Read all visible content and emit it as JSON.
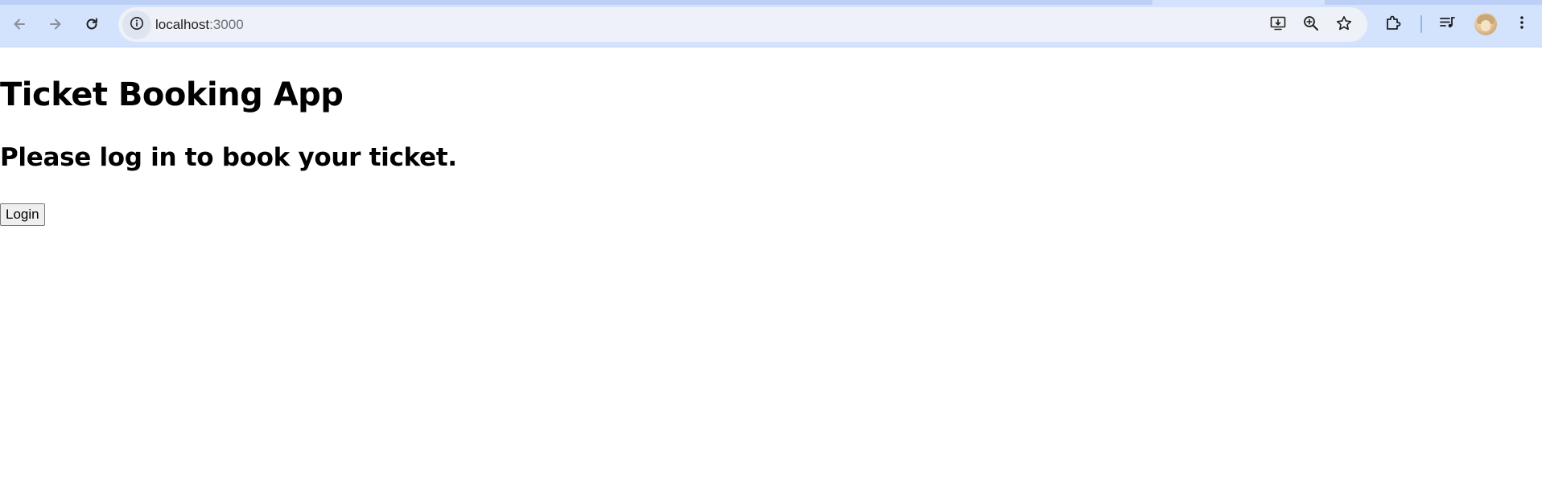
{
  "browser": {
    "url_host": "localhost",
    "url_port": ":3000",
    "icons": {
      "back": "arrow-back-icon",
      "forward": "arrow-forward-icon",
      "reload": "reload-icon",
      "site_info": "info-icon",
      "install_app": "install-app-icon",
      "zoom": "zoom-in-icon",
      "bookmark": "star-icon",
      "extensions": "puzzle-icon",
      "media": "media-queue-icon",
      "profile": "avatar",
      "menu": "more-vert-icon"
    },
    "colors": {
      "toolbar_bg": "#d3e3fd",
      "omnibox_bg": "#eef1f7"
    }
  },
  "page": {
    "title": "Ticket Booking App",
    "subtitle": "Please log in to book your ticket.",
    "login_button": "Login"
  }
}
